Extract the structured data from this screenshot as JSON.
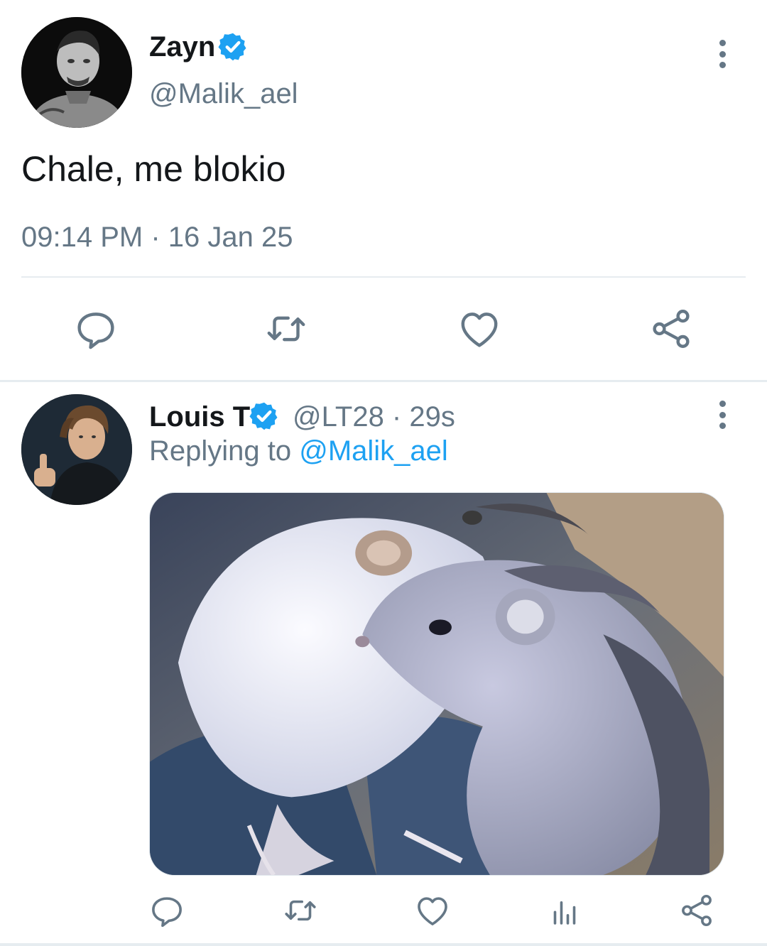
{
  "main_tweet": {
    "author": {
      "name": "Zayn",
      "handle": "@Malik_ael",
      "verified": true
    },
    "text": "Chale, me blokio",
    "timestamp": "09:14 PM · 16 Jan 25",
    "actions": [
      "reply-icon",
      "retweet-icon",
      "like-icon",
      "share-icon"
    ]
  },
  "reply_tweet": {
    "author": {
      "name": "Louis T",
      "handle_time": "@LT28 · 29s",
      "verified": true
    },
    "replying_prefix": "Replying to ",
    "replying_to": "@Malik_ael",
    "media": {
      "alt_icon": "rats-photo"
    },
    "actions": [
      "reply-icon",
      "retweet-icon",
      "like-icon",
      "stats-icon",
      "share-icon"
    ]
  },
  "colors": {
    "text": "#14171a",
    "secondary": "#657786",
    "accent": "#1da1f2",
    "divider": "#e6ecf0"
  }
}
